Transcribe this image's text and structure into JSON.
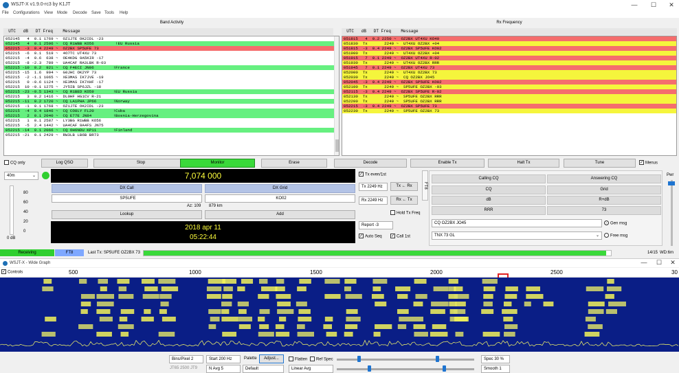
{
  "title": "WSJT-X   v1.9.0-rc3   by K1JT",
  "window_controls": {
    "minimize": "—",
    "maximize": "☐",
    "close": "✕"
  },
  "menu": [
    "File",
    "Configurations",
    "View",
    "Mode",
    "Decode",
    "Save",
    "Tools",
    "Help"
  ],
  "band_activity": {
    "title": "Band Activity",
    "header": "  UTC   dB   DT Freq    Message",
    "rows": [
      {
        "text": "052145   4  0.1 1769 ~  OZ1JTE OK2IDL -23",
        "bg": "#ffffff"
      },
      {
        "text": "052145   4  0.1 2596 ~  CQ R1WBB KO56         !EU Russia",
        "bg": "#66f080"
      },
      {
        "text": "052215  -3  0.4 2249 ~  OZ2BX SP5UFE 73",
        "bg": "#f56d6d"
      },
      {
        "text": "052215  -6  0.1  519 ~  4O7TC UT4XU 73",
        "bg": "#ffffff"
      },
      {
        "text": "052215  -4  0.6  638 ~  OE4KDG 9A5KIR -17",
        "bg": "#ffffff"
      },
      {
        "text": "052215  -8 -2.3  789 ~  UA4CAF RA3LBK R-03",
        "bg": "#ffffff"
      },
      {
        "text": "052215 -10  0.2  921 ~  CQ F4ECI JN06        !France",
        "bg": "#66f080"
      },
      {
        "text": "052215 -15  1.6  994 ~  G0JHC OK2YP 73",
        "bg": "#ffffff"
      },
      {
        "text": "052215  -2 -1.1 1065 ~  XE3MAS IK7JVE -19",
        "bg": "#ffffff"
      },
      {
        "text": "052215   0 -0.6 1124 ~  XE3MAS IK7XHF -17",
        "bg": "#ffffff"
      },
      {
        "text": "052215  10 -0.1 1275 ~  JY5IB SP6JZL -18",
        "bg": "#ffffff"
      },
      {
        "text": "052215 -23 -0.5 1343 ~  CQ R1BED KO59        !EU Russia",
        "bg": "#66f080"
      },
      {
        "text": "052215   3  0.2 1416 ~  DL0HF HG1CV R-21",
        "bg": "#ffffff"
      },
      {
        "text": "052215 -11  0.2 1720 ~  CQ LA1PHA JP66       !Norway",
        "bg": "#66f080"
      },
      {
        "text": "052215  -1  0.1 1768 ~  OZ1JTE OK2IDL -23",
        "bg": "#ffffff"
      },
      {
        "text": "052215  -4  0.4 1846 ~  CQ CO8LY FL20        !Cuba",
        "bg": "#66f080"
      },
      {
        "text": "052215   2  0.1 2040 ~  CQ E77E JN84         !Bosnia-Herzegovina",
        "bg": "#66f080"
      },
      {
        "text": "052215   1  0.1 2587 ~  LY3BG R1WBB KO56",
        "bg": "#ffffff"
      },
      {
        "text": "052215  -5  2.4 1442 ~  UA4CAF 9A4FS JN75",
        "bg": "#ffffff"
      },
      {
        "text": "052215 -14  0.1 2066 ~  CQ OH6NDU KP11       !Finland",
        "bg": "#66f080"
      },
      {
        "text": "052215 -21  0.1 2429 ~  RW3LB LB6B BR73",
        "bg": "#ffffff"
      }
    ]
  },
  "rx_frequency": {
    "title": "Rx Frequency",
    "header": "  UTC   dB   DT Freq    Message",
    "rows": [
      {
        "text": "051815   4  0.2 2250 ~  OZ2BX UT4XU KO40",
        "bg": "#f56d6d"
      },
      {
        "text": "051830  Tx       2249 ~  UT4XU OZ2BX +04",
        "bg": "#f5f53c"
      },
      {
        "text": "051815  -3  0.4 2249 ~  OZ2BX SP5UFE KO02",
        "bg": "#f56d6d"
      },
      {
        "text": "051900  Tx       2249 ~  UT4XU OZ2BX +04",
        "bg": "#f5f53c"
      },
      {
        "text": "051915   7  0.1 2249 ~  OZ2BX UT4XU R-02",
        "bg": "#f56d6d"
      },
      {
        "text": "051930  Tx       2249 ~  UT4XU OZ2BX RRR",
        "bg": "#f5f53c"
      },
      {
        "text": "051945   7  0.1 2249 ~  OZ2BX UT4XU 73",
        "bg": "#f56d6d"
      },
      {
        "text": "052000  Tx       2249 ~  UT4XU OZ2BX 73",
        "bg": "#f5f53c"
      },
      {
        "text": "052030  Tx       2249 ~  CQ OZ2BX JO45",
        "bg": "#f5f53c"
      },
      {
        "text": "052045  -3  0.4 2249 ~  OZ2BX SP5UFE KO02",
        "bg": "#f56d6d"
      },
      {
        "text": "052100  Tx       2249 ~  SP5UFE OZ2BX -03",
        "bg": "#f5f53c"
      },
      {
        "text": "052115  -3  0.4 2249 ~  OZ2BX SP5UFE R-02",
        "bg": "#f56d6d"
      },
      {
        "text": "052130  Tx       2249 ~  SP5UFE OZ2BX RRR",
        "bg": "#f5f53c"
      },
      {
        "text": "052200  Tx       2249 ~  SP5UFE OZ2BX RRR",
        "bg": "#f5f53c"
      },
      {
        "text": "052215  -3  0.4 2249 ~  OZ2BX SP5UFE 73",
        "bg": "#f56d6d"
      },
      {
        "text": "052230  Tx       2249 ~  SP5UFE OZ2BX 73",
        "bg": "#f5f53c"
      }
    ]
  },
  "buttons": {
    "cq_only": "CQ only",
    "log_qso": "Log QSO",
    "stop": "Stop",
    "monitor": "Monitor",
    "erase": "Erase",
    "decode": "Decode",
    "enable_tx": "Enable Tx",
    "halt_tx": "Halt Tx",
    "tune": "Tune",
    "menus": "Menus"
  },
  "band": "40m",
  "frequency": "7,074 000",
  "dx": {
    "call_label": "DX Call",
    "grid_label": "DX Grid",
    "call": "SP5UFE",
    "grid": "KO02",
    "az": "Az: 109",
    "distance": "879 km",
    "lookup": "Lookup",
    "add": "Add"
  },
  "datetime": {
    "date": "2018 apr 11",
    "time": "05:22:44"
  },
  "level": {
    "ticks": [
      "80",
      "60",
      "40",
      "20",
      "0"
    ],
    "db": "0 dB"
  },
  "tx_controls": {
    "tx_even": "Tx even/1st",
    "tx_hz": "Tx  2249  Hz",
    "rx_hz": "Rx  2249  Hz",
    "tx_from_rx": "Tx ← Rx",
    "rx_from_tx": "Rx ← Tx",
    "hold": "Hold Tx Freq",
    "report": "Report  -3",
    "auto_seq": "Auto Seq",
    "call_1st": "Call 1st"
  },
  "side_tab": "FT8",
  "qso": {
    "calling_cq": "Calling CQ",
    "answering_cq": "Answering CQ",
    "cq": "CQ",
    "grid": "Grid",
    "db": "dB",
    "rdb": "R+dB",
    "rrr": "RRR",
    "s73": "73",
    "msg1": "CQ OZ2BX JO45",
    "gen_msg": "Gen msg",
    "msg2": "TNX 73 GL",
    "free_msg": "Free msg"
  },
  "pwr": "Pwr",
  "status": {
    "receiving": "Receiving",
    "mode": "FT8",
    "last_tx": "Last Tx: SP5UFE OZ2BX 73",
    "progress_fraction": 0.99,
    "count": "14/15",
    "wd": "WD:6m"
  },
  "wide_graph": {
    "title": "WSJT-X - Wide Graph",
    "controls": "Controls",
    "freq_ticks": [
      "500",
      "1000",
      "1500",
      "2000",
      "2500",
      "30"
    ]
  },
  "wg_controls": {
    "bins": "Bins/Pixel  2",
    "start": "Start  200 Hz",
    "palette": "Palette",
    "adjust": "Adjust...",
    "flatten": "Flatten",
    "ref_spec": "Ref Spec",
    "spec": "Spec  30 %",
    "navg": "N Avg  5",
    "default": "Default",
    "linear": "Linear Avg",
    "smooth": "Smooth  1",
    "jt65": "JT65  2500  JT9"
  },
  "colors": {
    "green": "#66f080",
    "red": "#f56d6d",
    "yellow": "#f5f53c",
    "monitor": "#3ad93a",
    "receiving": "#2fcf2f",
    "ft8": "#7fa8ff",
    "waterfall": "#071a7a"
  }
}
